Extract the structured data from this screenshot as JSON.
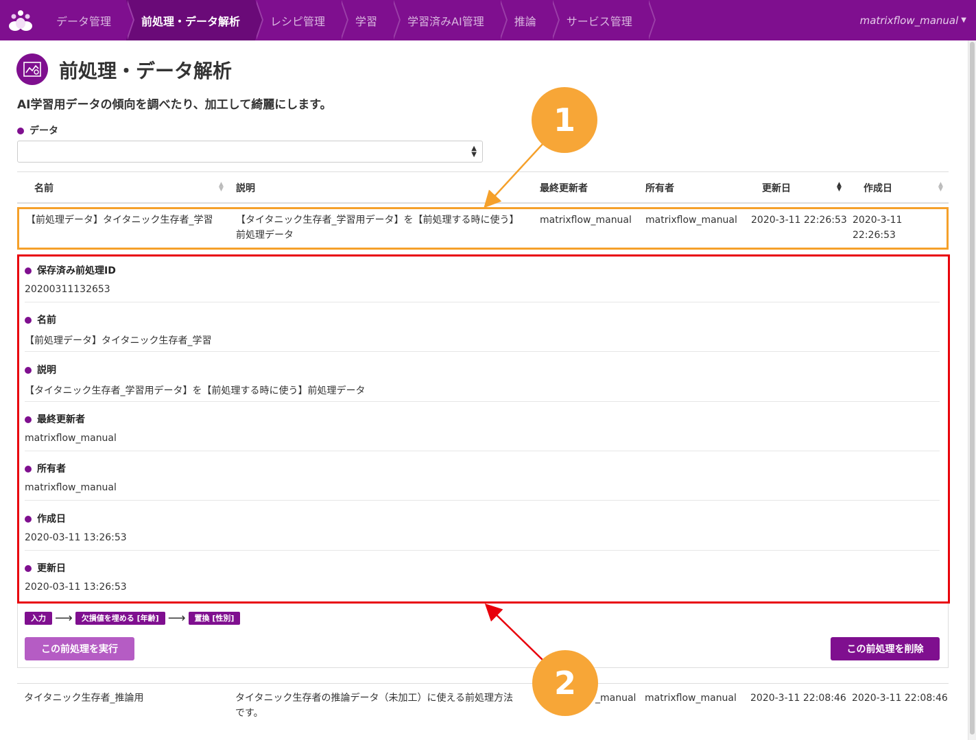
{
  "nav": {
    "items": [
      {
        "label": "データ管理",
        "active": false
      },
      {
        "label": "前処理・データ解析",
        "active": true
      },
      {
        "label": "レシピ管理",
        "active": false
      },
      {
        "label": "学習",
        "active": false
      },
      {
        "label": "学習済みAI管理",
        "active": false
      },
      {
        "label": "推論",
        "active": false
      },
      {
        "label": "サービス管理",
        "active": false
      }
    ],
    "user": "matrixflow_manual"
  },
  "header": {
    "title": "前処理・データ解析",
    "description": "AI学習用データの傾向を調べたり、加工して綺麗にします。"
  },
  "data_select": {
    "label": "データ",
    "value": ""
  },
  "table": {
    "columns": [
      "名前",
      "説明",
      "最終更新者",
      "所有者",
      "更新日",
      "作成日"
    ],
    "rows": [
      {
        "name": "【前処理データ】タイタニック生存者_学習",
        "description": "【タイタニック生存者_学習用データ】を【前処理する時に使う】前処理データ",
        "updater": "matrixflow_manual",
        "owner": "matrixflow_manual",
        "updated": "2020-3-11 22:26:53",
        "created": "2020-3-11 22:26:53"
      },
      {
        "name": "タイタニック生存者_推論用",
        "description": "タイタニック生存者の推論データ（未加工）に使える前処理方法です。",
        "updater": "_manual",
        "owner": "matrixflow_manual",
        "updated": "2020-3-11 22:08:46",
        "created": "2020-3-11 22:08:46"
      }
    ]
  },
  "details": [
    {
      "label": "保存済み前処理ID",
      "value": "20200311132653"
    },
    {
      "label": "名前",
      "value": "【前処理データ】タイタニック生存者_学習"
    },
    {
      "label": "説明",
      "value": "【タイタニック生存者_学習用データ】を【前処理する時に使う】前処理データ"
    },
    {
      "label": "最終更新者",
      "value": "matrixflow_manual"
    },
    {
      "label": "所有者",
      "value": "matrixflow_manual"
    },
    {
      "label": "作成日",
      "value": "2020-03-11 13:26:53"
    },
    {
      "label": "更新日",
      "value": "2020-03-11 13:26:53"
    }
  ],
  "pipeline": [
    "入力",
    "欠損値を埋める [年齢]",
    "置換 [性別]"
  ],
  "buttons": {
    "run": "この前処理を実行",
    "delete": "この前処理を削除"
  },
  "annotations": {
    "badge1": "1",
    "badge2": "2"
  },
  "colors": {
    "brand": "#7f0f8f",
    "highlight_orange": "#f5a02a",
    "highlight_red": "#e8000b"
  }
}
